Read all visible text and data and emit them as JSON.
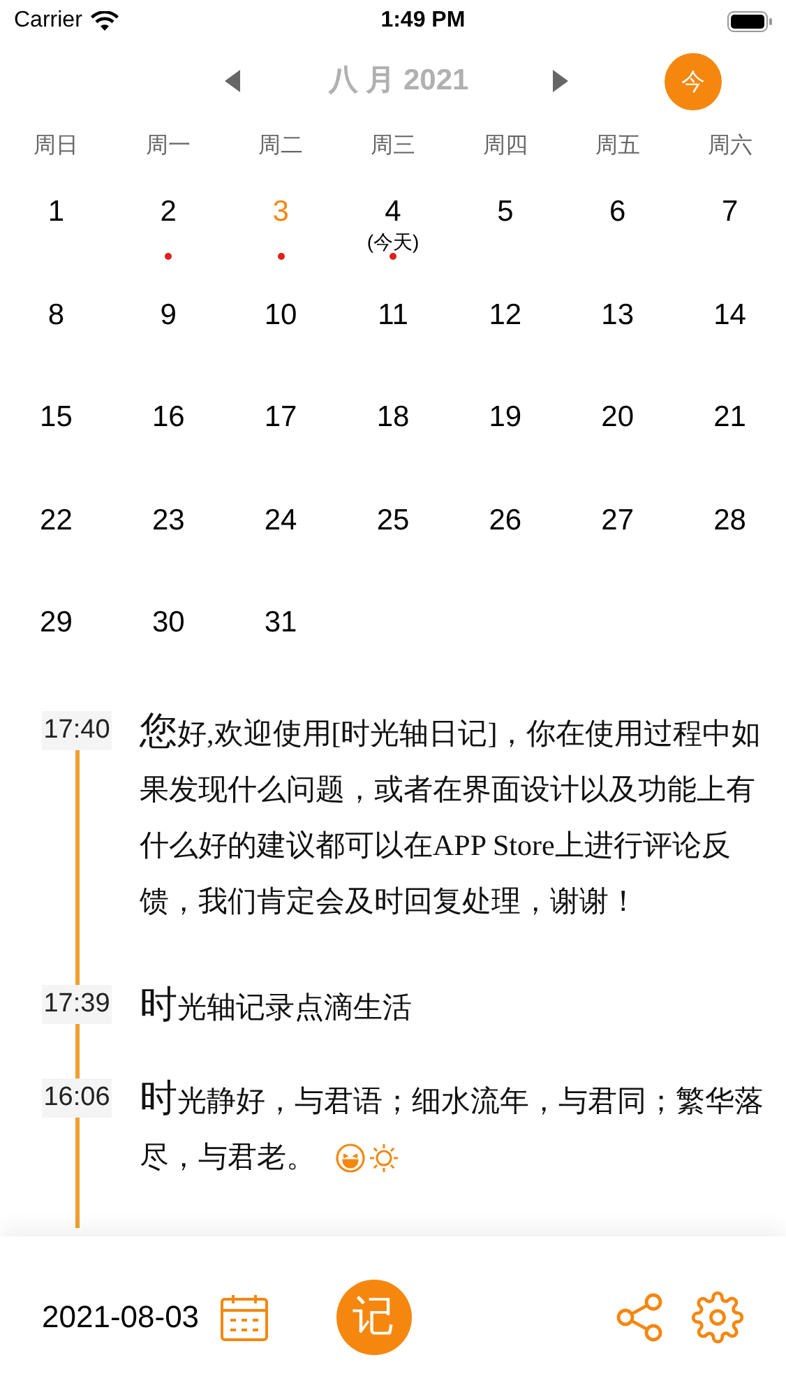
{
  "status_bar": {
    "carrier": "Carrier",
    "time": "1:49 PM"
  },
  "calendar": {
    "month_title": "八 月 2021",
    "today_button": "今",
    "weekdays": [
      "周日",
      "周一",
      "周二",
      "周三",
      "周四",
      "周五",
      "周六"
    ],
    "days": [
      {
        "label": "1",
        "selected": false,
        "has_entry": false
      },
      {
        "label": "2",
        "selected": false,
        "has_entry": true
      },
      {
        "label": "3",
        "selected": true,
        "has_entry": true
      },
      {
        "label": "4",
        "selected": false,
        "has_entry": true,
        "note": "(今天)"
      },
      {
        "label": "5",
        "selected": false,
        "has_entry": false
      },
      {
        "label": "6",
        "selected": false,
        "has_entry": false
      },
      {
        "label": "7",
        "selected": false,
        "has_entry": false
      },
      {
        "label": "8",
        "selected": false,
        "has_entry": false
      },
      {
        "label": "9",
        "selected": false,
        "has_entry": false
      },
      {
        "label": "10",
        "selected": false,
        "has_entry": false
      },
      {
        "label": "11",
        "selected": false,
        "has_entry": false
      },
      {
        "label": "12",
        "selected": false,
        "has_entry": false
      },
      {
        "label": "13",
        "selected": false,
        "has_entry": false
      },
      {
        "label": "14",
        "selected": false,
        "has_entry": false
      },
      {
        "label": "15",
        "selected": false,
        "has_entry": false
      },
      {
        "label": "16",
        "selected": false,
        "has_entry": false
      },
      {
        "label": "17",
        "selected": false,
        "has_entry": false
      },
      {
        "label": "18",
        "selected": false,
        "has_entry": false
      },
      {
        "label": "19",
        "selected": false,
        "has_entry": false
      },
      {
        "label": "20",
        "selected": false,
        "has_entry": false
      },
      {
        "label": "21",
        "selected": false,
        "has_entry": false
      },
      {
        "label": "22",
        "selected": false,
        "has_entry": false
      },
      {
        "label": "23",
        "selected": false,
        "has_entry": false
      },
      {
        "label": "24",
        "selected": false,
        "has_entry": false
      },
      {
        "label": "25",
        "selected": false,
        "has_entry": false
      },
      {
        "label": "26",
        "selected": false,
        "has_entry": false
      },
      {
        "label": "27",
        "selected": false,
        "has_entry": false
      },
      {
        "label": "28",
        "selected": false,
        "has_entry": false
      },
      {
        "label": "29",
        "selected": false,
        "has_entry": false
      },
      {
        "label": "30",
        "selected": false,
        "has_entry": false
      },
      {
        "label": "31",
        "selected": false,
        "has_entry": false
      }
    ]
  },
  "entries": [
    {
      "time": "17:40",
      "initial": "您",
      "text": "好,欢迎使用[时光轴日记]，你在使用过程中如果发现什么问题，或者在界面设计以及功能上有什么好的建议都可以在APP Store上进行评论反馈，我们肯定会及时回复处理，谢谢！",
      "serif": true
    },
    {
      "time": "17:39",
      "initial": "时",
      "text": "光轴记录点滴生活",
      "serif": false
    },
    {
      "time": "16:06",
      "initial": "时",
      "text": "光静好，与君语；细水流年，与君同；繁华落尽，与君老。",
      "serif": false,
      "icons": [
        {
          "kind": "mood"
        },
        {
          "kind": "weather"
        }
      ]
    }
  ],
  "bottom_bar": {
    "date": "2021-08-03",
    "write_button": "记"
  }
}
